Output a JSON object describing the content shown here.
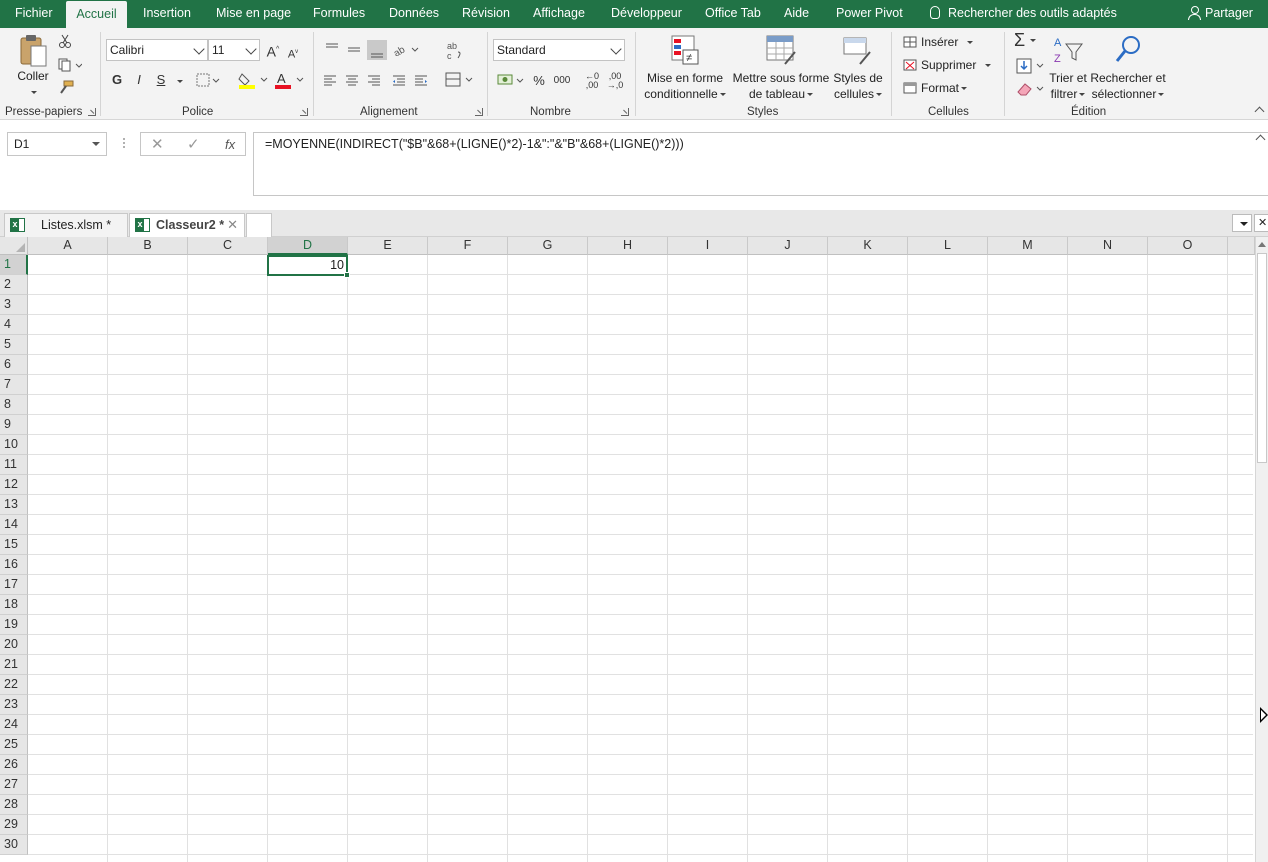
{
  "tabs": [
    {
      "label": "Fichier"
    },
    {
      "label": "Accueil"
    },
    {
      "label": "Insertion"
    },
    {
      "label": "Mise en page"
    },
    {
      "label": "Formules"
    },
    {
      "label": "Données"
    },
    {
      "label": "Révision"
    },
    {
      "label": "Affichage"
    },
    {
      "label": "Développeur"
    },
    {
      "label": "Office Tab"
    },
    {
      "label": "Aide"
    },
    {
      "label": "Power Pivot"
    }
  ],
  "active_tab": "Accueil",
  "search": {
    "label": "Rechercher des outils adaptés"
  },
  "share": {
    "label": "Partager"
  },
  "ribbon": {
    "clipboard": {
      "paste_label": "Coller",
      "group_label": "Presse-papiers"
    },
    "font": {
      "font_name": "Calibri",
      "font_size": "11",
      "bold": "G",
      "italic": "I",
      "underline": "S",
      "group_label": "Police"
    },
    "alignment": {
      "group_label": "Alignement"
    },
    "number": {
      "format": "Standard",
      "percent": "%",
      "thousands": "000",
      "group_label": "Nombre"
    },
    "styles": {
      "conditional_l1": "Mise en forme",
      "conditional_l2": "conditionnelle",
      "table_l1": "Mettre sous forme",
      "table_l2": "de tableau",
      "cellstyles_l1": "Styles de",
      "cellstyles_l2": "cellules",
      "group_label": "Styles"
    },
    "cells": {
      "insert": "Insérer",
      "delete": "Supprimer",
      "format": "Format",
      "group_label": "Cellules"
    },
    "editing": {
      "sort_l1": "Trier et",
      "sort_l2": "filtrer",
      "find_l1": "Rechercher et",
      "find_l2": "sélectionner",
      "group_label": "Édition"
    }
  },
  "formula_bar": {
    "name_box": "D1",
    "fx": "fx",
    "formula": "=MOYENNE(INDIRECT(\"$B\"&68+(LIGNE()*2)-1&\":\"&\"B\"&68+(LIGNE()*2)))"
  },
  "workbooks": [
    {
      "label": "Listes.xlsm *"
    },
    {
      "label": "Classeur2 *"
    }
  ],
  "grid": {
    "columns": [
      "A",
      "B",
      "C",
      "D",
      "E",
      "F",
      "G",
      "H",
      "I",
      "J",
      "K",
      "L",
      "M",
      "N",
      "O"
    ],
    "rows": [
      "1",
      "2",
      "3",
      "4",
      "5",
      "6",
      "7",
      "8",
      "9",
      "10",
      "11",
      "12",
      "13",
      "14",
      "15",
      "16",
      "17",
      "18",
      "19",
      "20",
      "21",
      "22",
      "23",
      "24",
      "25",
      "26",
      "27",
      "28",
      "29",
      "30"
    ],
    "selected_cell": "D1",
    "selected_value": "10"
  },
  "colors": {
    "accent": "#217346"
  }
}
